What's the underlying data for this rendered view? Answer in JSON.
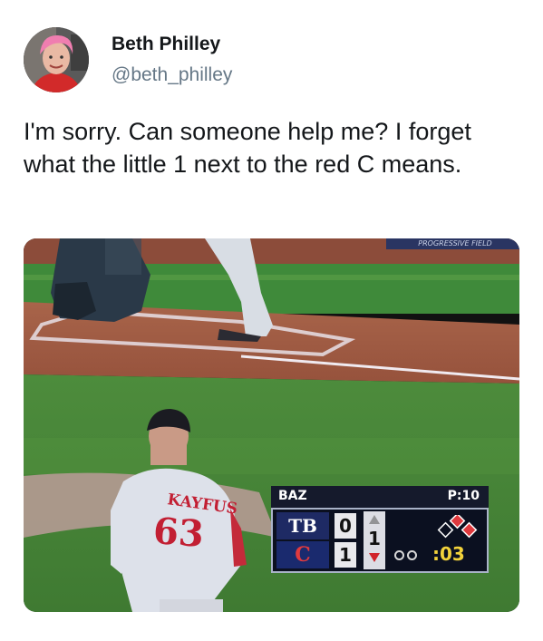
{
  "tweet": {
    "author_name": "Beth Philley",
    "author_handle": "@beth_philley",
    "text": "I'm sorry. Can someone help me? I forget what the little 1 next to the red C means.",
    "avatar_icon": "avatar-photo"
  },
  "photo": {
    "jersey_name": "KAYFUS",
    "jersey_number": "63",
    "stadium_sign": "PROGRESSIVE FIELD",
    "scoreboard": {
      "pitcher": "BAZ",
      "pitch_count": "P:10",
      "away_team": "TB",
      "away_score": "0",
      "home_team": "C",
      "home_score": "1",
      "inning": "1",
      "inning_half": "bottom",
      "outs_shown": 0,
      "pitch_clock": ":03",
      "colors": {
        "home_logo": "#e03a3e",
        "inning_arrow": "#d1232a",
        "base_occupied": "#e03a3e",
        "clock": "#f2d23b"
      }
    }
  }
}
